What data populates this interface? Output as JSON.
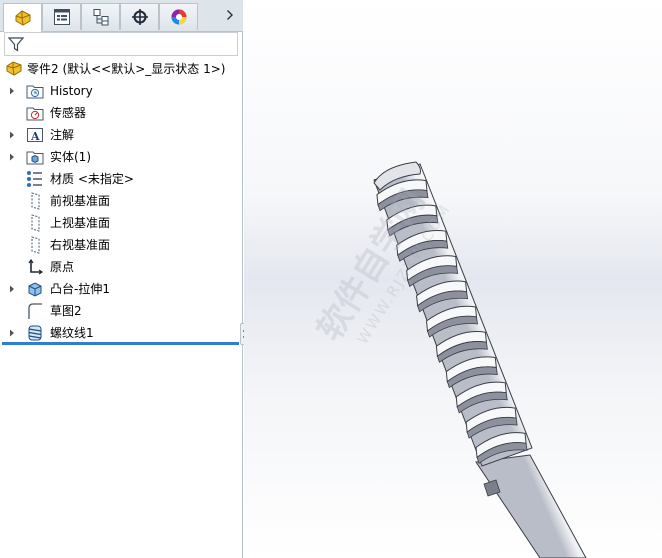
{
  "tabs": [
    {
      "name": "feature-manager",
      "icon": "feature-manager-icon",
      "active": true
    },
    {
      "name": "property-manager",
      "icon": "property-manager-icon",
      "active": false
    },
    {
      "name": "configuration-manager",
      "icon": "configuration-manager-icon",
      "active": false
    },
    {
      "name": "dimxpert-manager",
      "icon": "crosshair-icon",
      "active": false
    },
    {
      "name": "display-manager",
      "icon": "appearance-sphere-icon",
      "active": false
    }
  ],
  "tab_overflow_icon": "chevron-right-icon",
  "filter_icon": "filter-icon",
  "tree": {
    "root": "零件2  (默认<<默认>_显示状态 1>)",
    "items": [
      {
        "label": "History",
        "icon": "history-folder-icon",
        "expandable": true
      },
      {
        "label": "传感器",
        "icon": "sensors-icon",
        "expandable": false
      },
      {
        "label": "注解",
        "icon": "annotations-icon",
        "expandable": true
      },
      {
        "label": "实体(1)",
        "icon": "solid-bodies-icon",
        "expandable": true
      },
      {
        "label": "材质 <未指定>",
        "icon": "material-icon",
        "expandable": false
      },
      {
        "label": "前视基准面",
        "icon": "plane-icon",
        "expandable": false
      },
      {
        "label": "上视基准面",
        "icon": "plane-icon",
        "expandable": false
      },
      {
        "label": "右视基准面",
        "icon": "plane-icon",
        "expandable": false
      },
      {
        "label": "原点",
        "icon": "origin-icon",
        "expandable": false
      },
      {
        "label": "凸台-拉伸1",
        "icon": "extrude-icon",
        "expandable": true
      },
      {
        "label": "草图2",
        "icon": "sketch-icon",
        "expandable": false
      },
      {
        "label": "螺纹线1",
        "icon": "thread-feature-icon",
        "expandable": true
      }
    ]
  },
  "viewport": {
    "watermark_line1": "软件自学网",
    "watermark_line2": "WWW.RJZXW.COM",
    "model": "threaded-rod-part"
  },
  "colors": {
    "accent": "#2f7fd0",
    "part_yellow": "#f2c12e",
    "tab_bg": "#dde4ea",
    "model_shade": "#c9cdd6"
  }
}
